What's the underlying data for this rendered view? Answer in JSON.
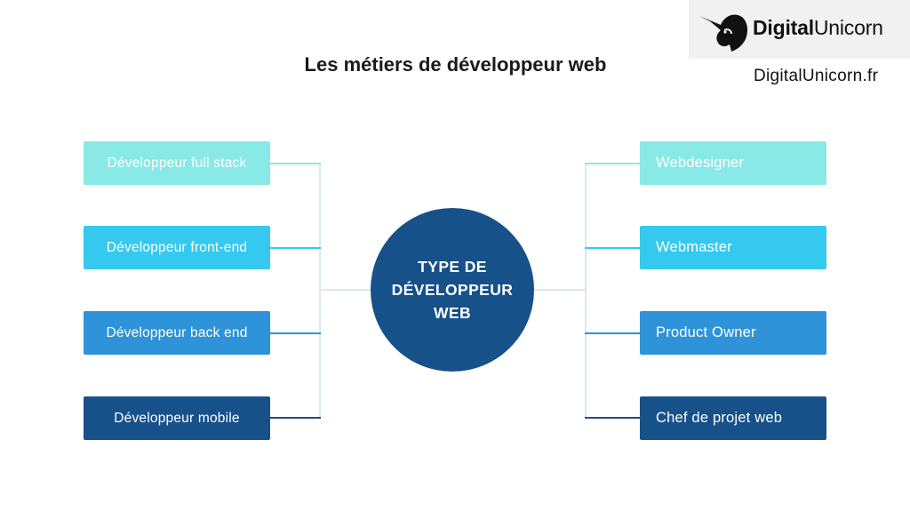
{
  "title": "Les métiers de développeur web",
  "brand": {
    "logo_icon": "unicorn-head-icon",
    "logo_bold": "Digital",
    "logo_light": "Unicorn",
    "site_url": "DigitalUnicorn.fr"
  },
  "hub": {
    "line1": "TYPE DE",
    "line2": "DÉVELOPPEUR",
    "line3": "WEB",
    "color": "#17518a"
  },
  "left_nodes": [
    {
      "label": "Développeur full stack",
      "color": "#88e9e7"
    },
    {
      "label": "Développeur front-end",
      "color": "#36c9ef"
    },
    {
      "label": "Développeur back end",
      "color": "#2e93d8"
    },
    {
      "label": "Développeur mobile",
      "color": "#17518a"
    }
  ],
  "right_nodes": [
    {
      "label": "Webdesigner",
      "color": "#88e9e7"
    },
    {
      "label": "Webmaster",
      "color": "#36c9ef"
    },
    {
      "label": "Product Owner",
      "color": "#2e93d8"
    },
    {
      "label": "Chef de projet web",
      "color": "#17518a"
    }
  ],
  "connector_color": "#dde7f0"
}
